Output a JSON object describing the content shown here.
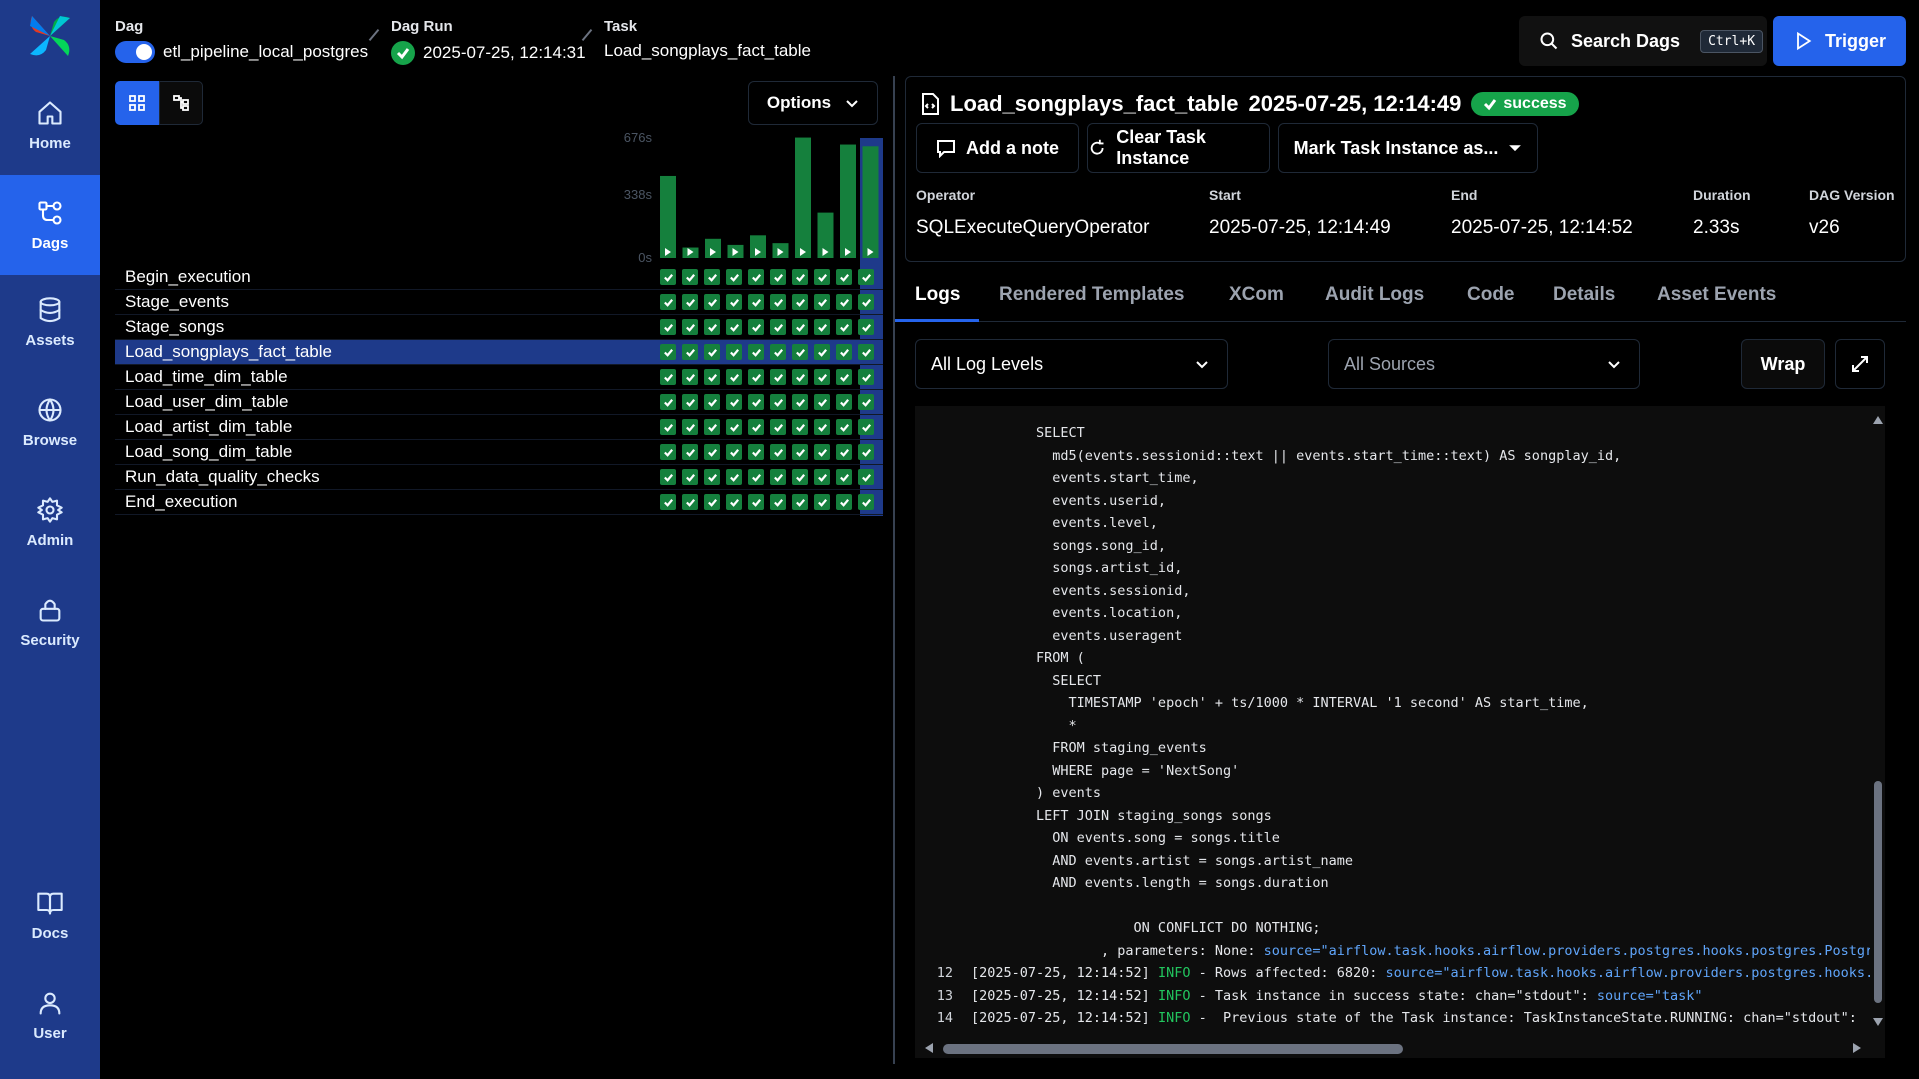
{
  "sidebar": {
    "items": [
      {
        "label": "Home",
        "icon": "home-icon"
      },
      {
        "label": "Dags",
        "icon": "dags-icon",
        "active": true
      },
      {
        "label": "Assets",
        "icon": "database-icon"
      },
      {
        "label": "Browse",
        "icon": "globe-icon"
      },
      {
        "label": "Admin",
        "icon": "gear-icon"
      },
      {
        "label": "Security",
        "icon": "lock-icon"
      },
      {
        "label": "Docs",
        "icon": "book-icon"
      },
      {
        "label": "User",
        "icon": "user-icon"
      }
    ]
  },
  "breadcrumb": {
    "dag_label": "Dag",
    "dag_value": "etl_pipeline_local_postgres",
    "run_label": "Dag Run",
    "run_value": "2025-07-25, 12:14:31",
    "task_label": "Task",
    "task_value": "Load_songplays_fact_table"
  },
  "header": {
    "search_label": "Search Dags",
    "search_shortcut": "Ctrl+K",
    "trigger_label": "Trigger"
  },
  "grid": {
    "options_label": "Options",
    "duration_ticks": [
      "676s",
      "338s",
      "0s"
    ],
    "duration_max": 676,
    "run_durations": [
      470,
      60,
      110,
      75,
      130,
      85,
      690,
      260,
      650,
      640
    ],
    "selected_run_index": 9,
    "tasks": [
      "Begin_execution",
      "Stage_events",
      "Stage_songs",
      "Load_songplays_fact_table",
      "Load_time_dim_table",
      "Load_user_dim_table",
      "Load_artist_dim_table",
      "Load_song_dim_table",
      "Run_data_quality_checks",
      "End_execution"
    ],
    "selected_task_index": 3,
    "status_color": "#15803d"
  },
  "task_instance": {
    "title": "Load_songplays_fact_table",
    "timestamp": "2025-07-25, 12:14:49",
    "status": "success",
    "add_note_label": "Add a note",
    "clear_label": "Clear Task Instance",
    "mark_label": "Mark Task Instance as...",
    "meta": [
      {
        "label": "Operator",
        "value": "SQLExecuteQueryOperator"
      },
      {
        "label": "Start",
        "value": "2025-07-25, 12:14:49"
      },
      {
        "label": "End",
        "value": "2025-07-25, 12:14:52"
      },
      {
        "label": "Duration",
        "value": "2.33s"
      },
      {
        "label": "DAG Version",
        "value": "v26"
      }
    ]
  },
  "tabs": [
    "Logs",
    "Rendered Templates",
    "XCom",
    "Audit Logs",
    "Code",
    "Details",
    "Asset Events"
  ],
  "log_controls": {
    "level_select": "All Log Levels",
    "source_select": "All Sources",
    "wrap_label": "Wrap"
  },
  "log_lines": [
    {
      "n": "",
      "text": "        SELECT"
    },
    {
      "n": "",
      "text": "          md5(events.sessionid::text || events.start_time::text) AS songplay_id,"
    },
    {
      "n": "",
      "text": "          events.start_time,"
    },
    {
      "n": "",
      "text": "          events.userid,"
    },
    {
      "n": "",
      "text": "          events.level,"
    },
    {
      "n": "",
      "text": "          songs.song_id,"
    },
    {
      "n": "",
      "text": "          songs.artist_id,"
    },
    {
      "n": "",
      "text": "          events.sessionid,"
    },
    {
      "n": "",
      "text": "          events.location,"
    },
    {
      "n": "",
      "text": "          events.useragent"
    },
    {
      "n": "",
      "text": "        FROM ("
    },
    {
      "n": "",
      "text": "          SELECT"
    },
    {
      "n": "",
      "text": "            TIMESTAMP 'epoch' + ts/1000 * INTERVAL '1 second' AS start_time,"
    },
    {
      "n": "",
      "text": "            *"
    },
    {
      "n": "",
      "text": "          FROM staging_events"
    },
    {
      "n": "",
      "text": "          WHERE page = 'NextSong'"
    },
    {
      "n": "",
      "text": "        ) events"
    },
    {
      "n": "",
      "text": "        LEFT JOIN staging_songs songs"
    },
    {
      "n": "",
      "text": "          ON events.song = songs.title"
    },
    {
      "n": "",
      "text": "          AND events.artist = songs.artist_name"
    },
    {
      "n": "",
      "text": "          AND events.length = songs.duration"
    },
    {
      "n": "",
      "text": ""
    },
    {
      "n": "",
      "text": "                    ON CONFLICT DO NOTHING;"
    },
    {
      "n": "",
      "text": "                , parameters: None: ",
      "source": "source=\"airflow.task.hooks.airflow.providers.postgres.hooks.postgres.PostgresHook\""
    },
    {
      "n": "12",
      "prefix": "[2025-07-25, 12:14:52] ",
      "level": "INFO",
      "text": " - Rows affected: 6820: ",
      "source": "source=\"airflow.task.hooks.airflow.providers.postgres.hooks.postgres.PostgresHook\""
    },
    {
      "n": "13",
      "prefix": "[2025-07-25, 12:14:52] ",
      "level": "INFO",
      "text": " - Task instance in success state: chan=\"stdout\": ",
      "source": "source=\"task\""
    },
    {
      "n": "14",
      "prefix": "[2025-07-25, 12:14:52] ",
      "level": "INFO",
      "text": " -  Previous state of the Task instance: TaskInstanceState.RUNNING: chan=\"stdout\": "
    }
  ]
}
